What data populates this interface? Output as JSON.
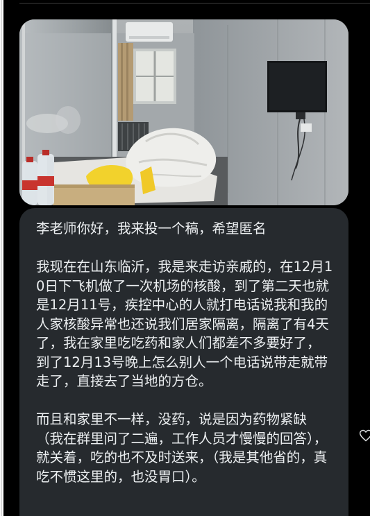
{
  "message": {
    "paragraphs": [
      "李老师你好，我来投一个稿，希望匿名",
      "我现在在山东临沂，我是来走访亲戚的，在12月10日下飞机做了一次机场的核酸，到了第二天也就是12月11号，疾控中心的人就打电话说我和我的人家核酸异常也还说我们居家隔离，隔离了有4天了，我在家里吃吃药和家人们都差不多要好了，到了12月13号晚上怎么别人一个电话说带走就带走了，直接去了当地的方仓。",
      "而且和家里不一样，没药，说是因为药物紧缺（我在群里问了二遍，工作人员才慢慢的回答），就关着，吃的也不及时送来，（我是其他省的，真吃不惯这里的，也没胃口）。"
    ]
  },
  "photo": {
    "scene": "quarantine-room",
    "colors": {
      "wall": "#9ea3a8",
      "floor": "#6f7275",
      "bedding": "#e9e9e6"
    }
  },
  "icons": {
    "reaction": "heart-icon"
  },
  "colors": {
    "background": "#000000",
    "bubble": "#262a2e",
    "text": "#eceff1"
  }
}
